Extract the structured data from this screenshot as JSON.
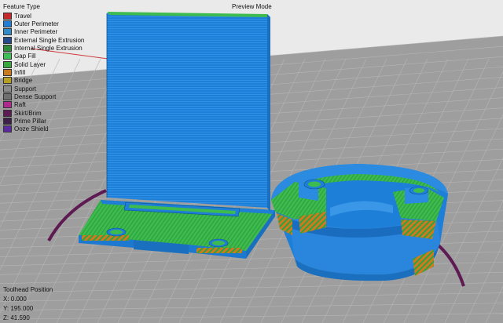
{
  "header": {
    "legend_title": "Feature Type",
    "mode_label": "Preview Mode"
  },
  "legend": [
    {
      "label": "Travel",
      "color": "#c8282d"
    },
    {
      "label": "Outer Perimeter",
      "color": "#1f7fd6"
    },
    {
      "label": "Inner Perimeter",
      "color": "#2f8bc9"
    },
    {
      "label": "External Single Extrusion",
      "color": "#264b8c"
    },
    {
      "label": "Internal Single Extrusion",
      "color": "#2f8a3a"
    },
    {
      "label": "Gap Fill",
      "color": "#3fbf58"
    },
    {
      "label": "Solid Layer",
      "color": "#38a83e"
    },
    {
      "label": "Infill",
      "color": "#c97a1c"
    },
    {
      "label": "Bridge",
      "color": "#b7a01f"
    },
    {
      "label": "Support",
      "color": "#8a8a8a"
    },
    {
      "label": "Dense Support",
      "color": "#6f6f6f"
    },
    {
      "label": "Raft",
      "color": "#b0298f"
    },
    {
      "label": "Skirt/Brim",
      "color": "#5e1a52"
    },
    {
      "label": "Prime Pillar",
      "color": "#3d1f4a"
    },
    {
      "label": "Ooze Shield",
      "color": "#5b2aa1"
    }
  ],
  "toolhead": {
    "title": "Toolhead Position",
    "x": "X: 0.000",
    "y": "Y: 195.000",
    "z": "Z: 41.590"
  },
  "colors": {
    "background": "#e9e9e9",
    "build_plate": "#9d9d9d",
    "grid_line": "#b9b9b9",
    "perimeter_blue": "#1f7fd6",
    "solid_green": "#38b34a",
    "infill_orange": "#c97a1c",
    "brim_purple": "#5e1a52"
  }
}
